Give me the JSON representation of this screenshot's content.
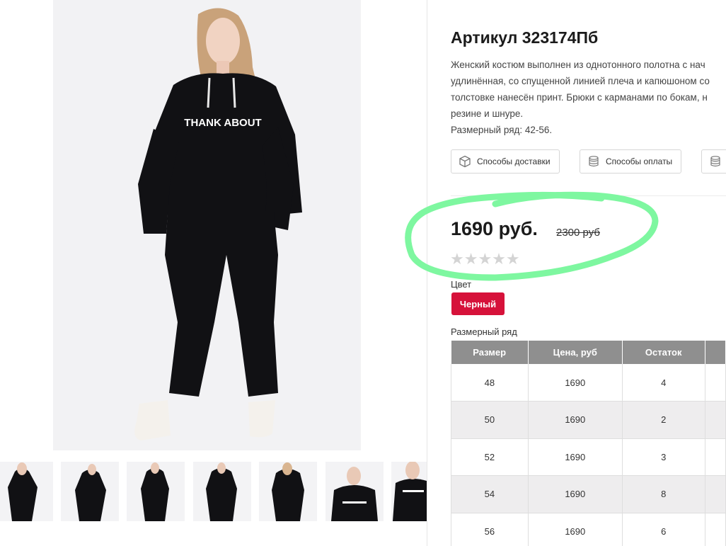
{
  "product": {
    "title": "Артикул 323174Пб",
    "description_lines": [
      "Женский костюм выполнен из однотонного полотна с нач",
      "удлинённая, со спущенной линией плеча и капюшоном со",
      "толстовке нанесён принт. Брюки с карманами по бокам, н",
      "резине и шнуре.",
      "Размерный ряд: 42-56."
    ],
    "print_text": "THANK ABOUT"
  },
  "buttons": {
    "delivery": "Способы доставки",
    "payment": "Способы оплаты",
    "delivery_icon": "box-icon",
    "payment_icon": "coins-icon",
    "third_icon": "coins-icon"
  },
  "pricing": {
    "price": "1690 руб.",
    "old_price": "2300 руб",
    "rating_stars": "★★★★★",
    "rating_value": 0,
    "rating_max": 5,
    "highlight_color": "#7ef7a0"
  },
  "color": {
    "label": "Цвет",
    "selected": "Черный",
    "chip_color": "#d6123a"
  },
  "sizes": {
    "label": "Размерный ряд",
    "headers": [
      "Размер",
      "Цена, руб",
      "Остаток"
    ],
    "rows": [
      [
        "48",
        "1690",
        "4"
      ],
      [
        "50",
        "1690",
        "2"
      ],
      [
        "52",
        "1690",
        "3"
      ],
      [
        "54",
        "1690",
        "8"
      ],
      [
        "56",
        "1690",
        "6"
      ]
    ]
  },
  "gallery": {
    "thumbnail_count": 7,
    "background_color": "#f2f2f4",
    "garment_color": "#111114"
  }
}
